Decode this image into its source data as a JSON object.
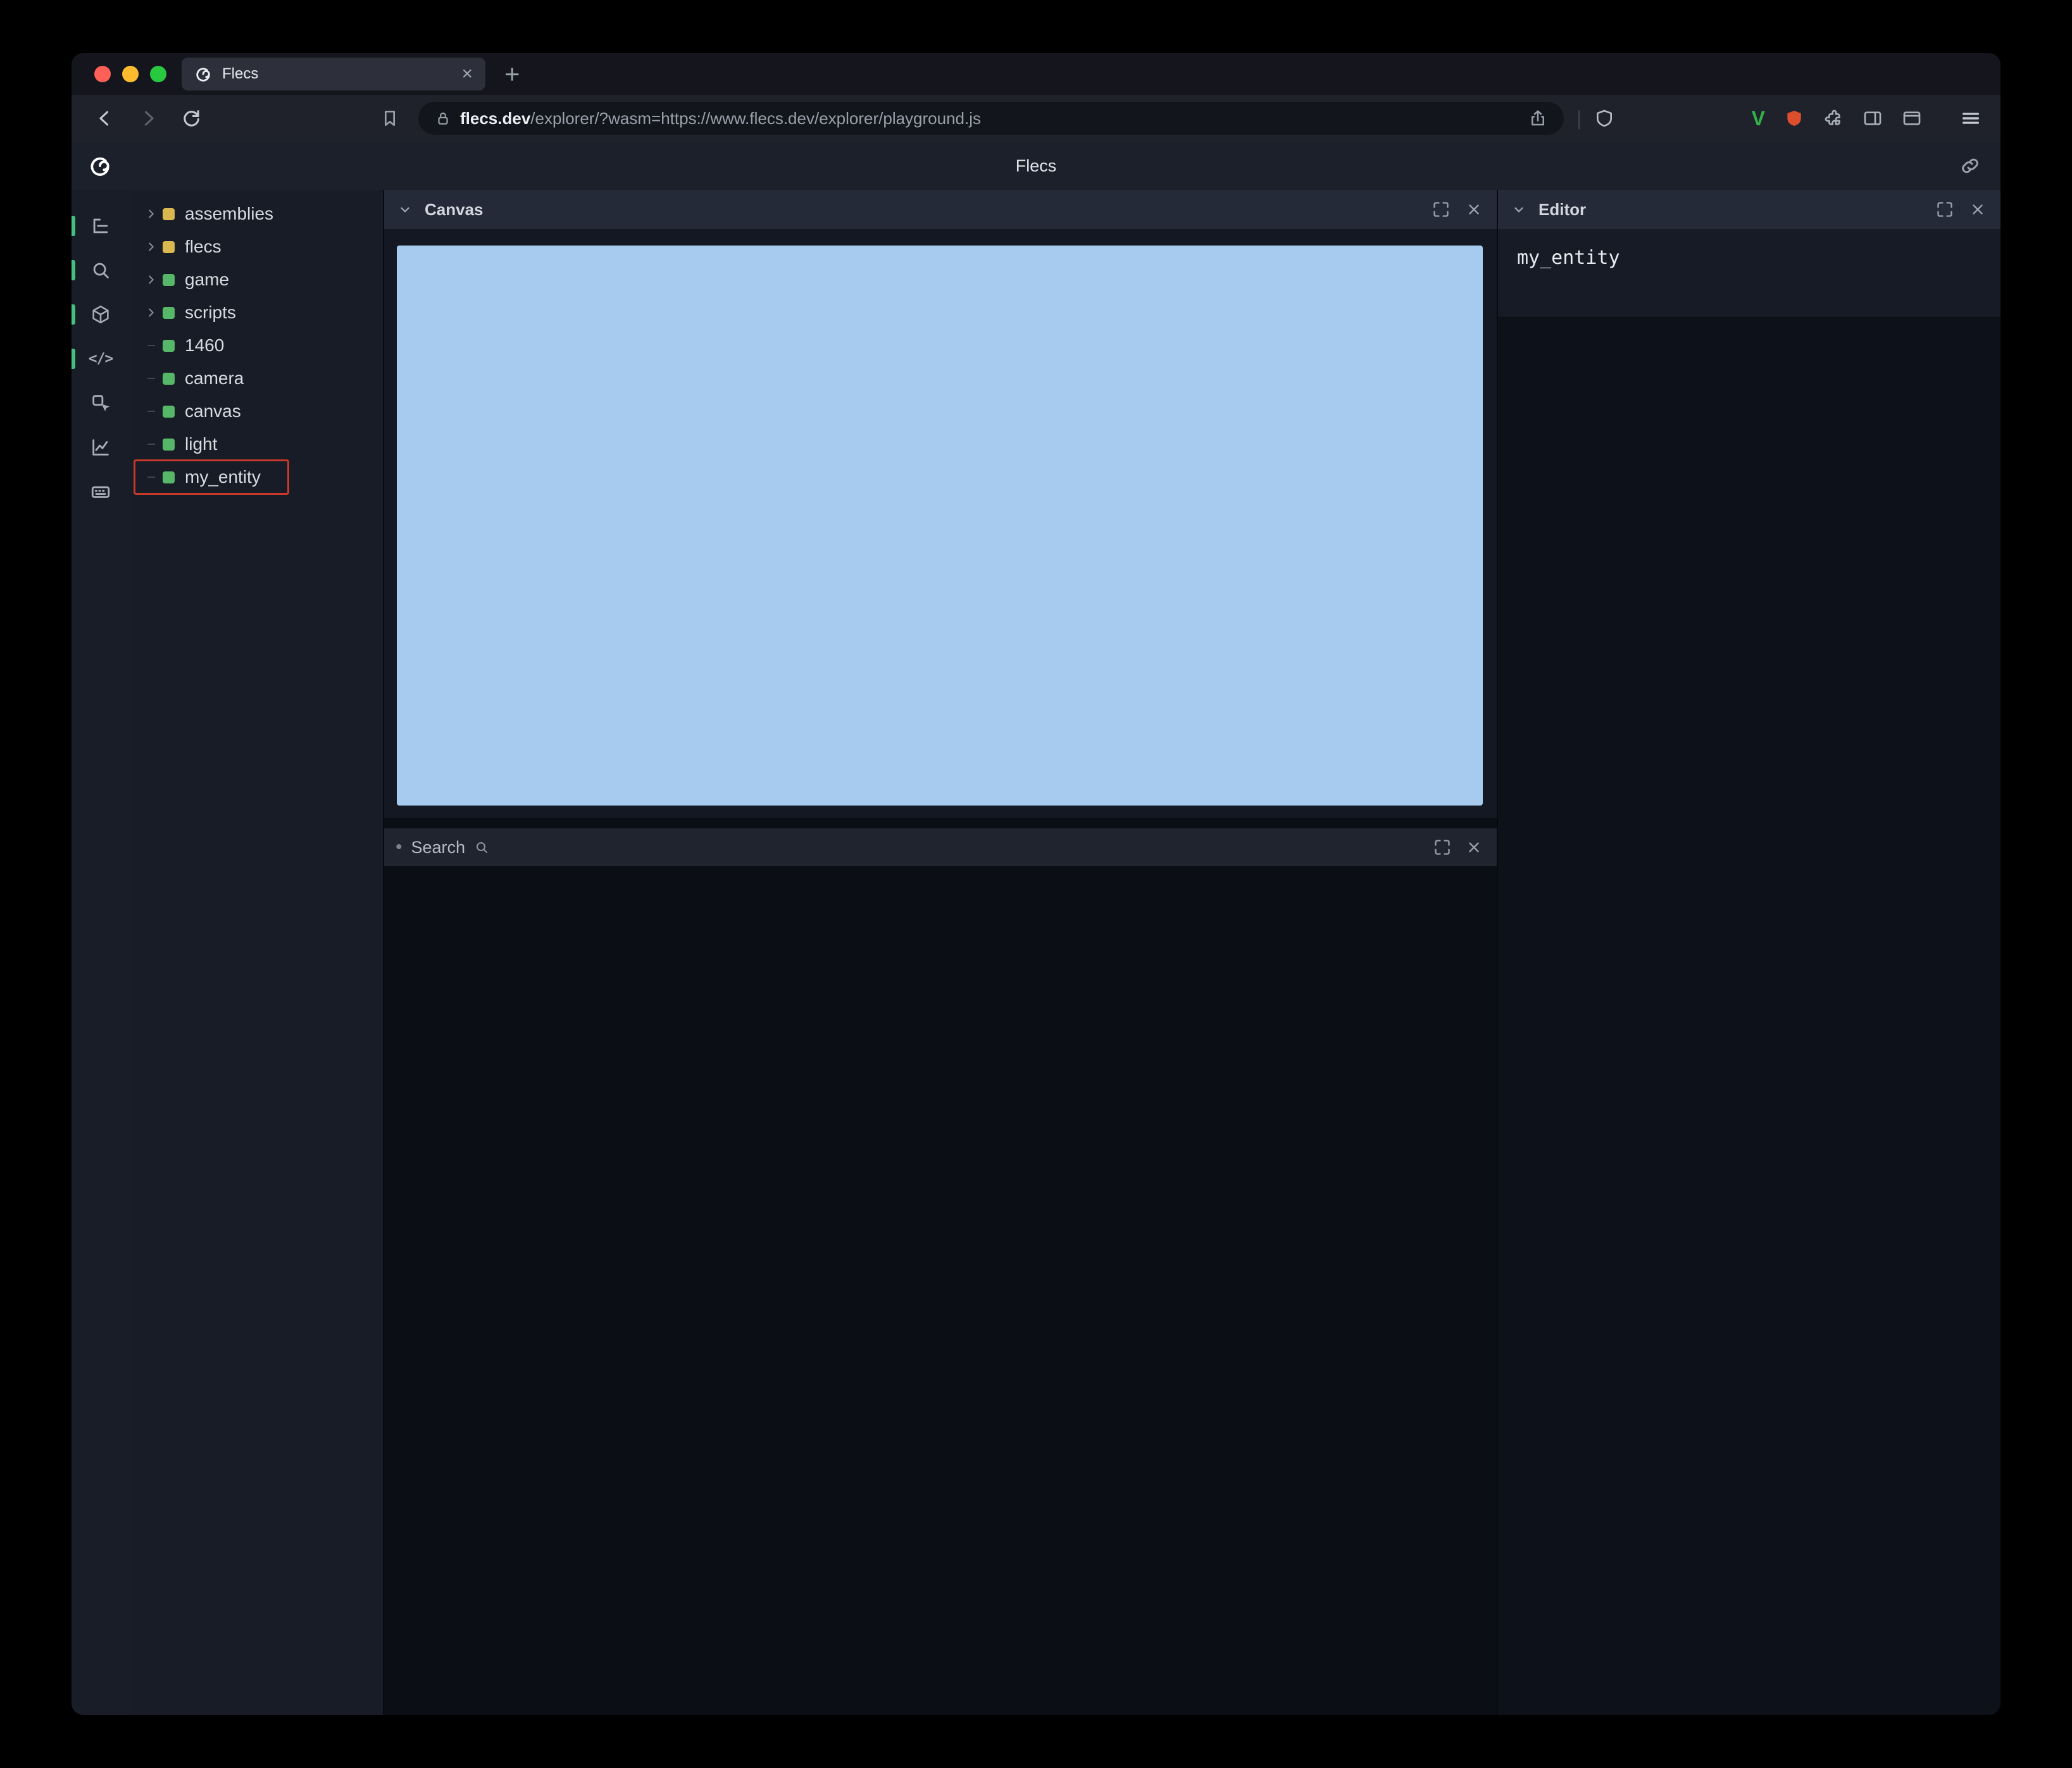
{
  "browser": {
    "tab": {
      "title": "Flecs"
    },
    "url": {
      "domain": "flecs.dev",
      "rest": "/explorer/?wasm=https://www.flecs.dev/explorer/playground.js"
    },
    "extensions": {
      "v_label": "V"
    },
    "glyphs": {
      "close_tab": "×",
      "new_tab": "+",
      "separator": "|"
    }
  },
  "app": {
    "header": {
      "title": "Flecs"
    },
    "tree": {
      "items": [
        {
          "label": "assemblies",
          "type": "module",
          "expandable": true
        },
        {
          "label": "flecs",
          "type": "module",
          "expandable": true
        },
        {
          "label": "game",
          "type": "entity",
          "expandable": true
        },
        {
          "label": "scripts",
          "type": "entity",
          "expandable": true
        },
        {
          "label": "1460",
          "type": "entity",
          "expandable": false
        },
        {
          "label": "camera",
          "type": "entity",
          "expandable": false
        },
        {
          "label": "canvas",
          "type": "entity",
          "expandable": false
        },
        {
          "label": "light",
          "type": "entity",
          "expandable": false
        },
        {
          "label": "my_entity",
          "type": "entity",
          "expandable": false,
          "annotated": true
        }
      ]
    },
    "panels": {
      "canvas": {
        "title": "Canvas"
      },
      "search": {
        "title": "Search",
        "bullet": "•"
      },
      "editor": {
        "title": "Editor",
        "content": "my_entity"
      }
    },
    "rail": {
      "code_icon_glyph": "</>"
    }
  },
  "colors": {
    "canvas_blue": "#a6cbef",
    "entity_green": "#57b768",
    "module_yellow": "#d9b850",
    "annotation_red": "#c8392b",
    "active_indicator_green": "#44c182"
  }
}
